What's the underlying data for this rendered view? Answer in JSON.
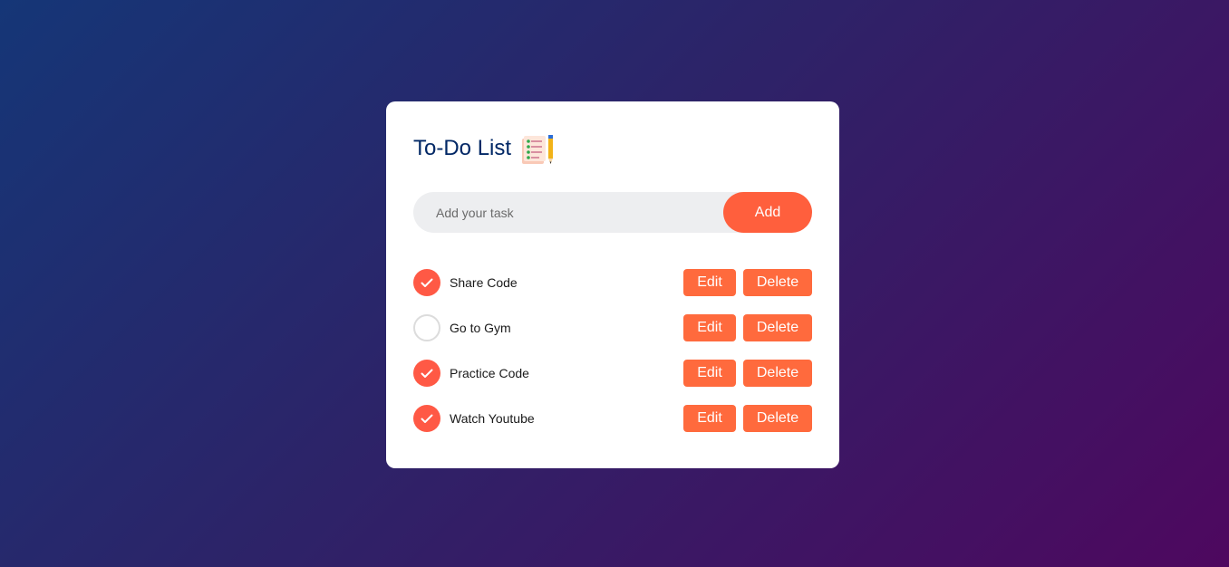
{
  "app": {
    "title": "To-Do List",
    "title_icon": "notepad-with-pencil-icon"
  },
  "input": {
    "placeholder": "Add your task",
    "value": "",
    "add_label": "Add"
  },
  "tasks": [
    {
      "label": "Share Code",
      "checked": true,
      "edit_label": "Edit",
      "delete_label": "Delete"
    },
    {
      "label": "Go to Gym",
      "checked": false,
      "edit_label": "Edit",
      "delete_label": "Delete"
    },
    {
      "label": "Practice Code",
      "checked": true,
      "edit_label": "Edit",
      "delete_label": "Delete"
    },
    {
      "label": "Watch Youtube",
      "checked": true,
      "edit_label": "Edit",
      "delete_label": "Delete"
    }
  ],
  "colors": {
    "accent": "#ff5f3d",
    "check": "#ff5945",
    "title": "#002765",
    "input_bg": "#edeef0"
  }
}
